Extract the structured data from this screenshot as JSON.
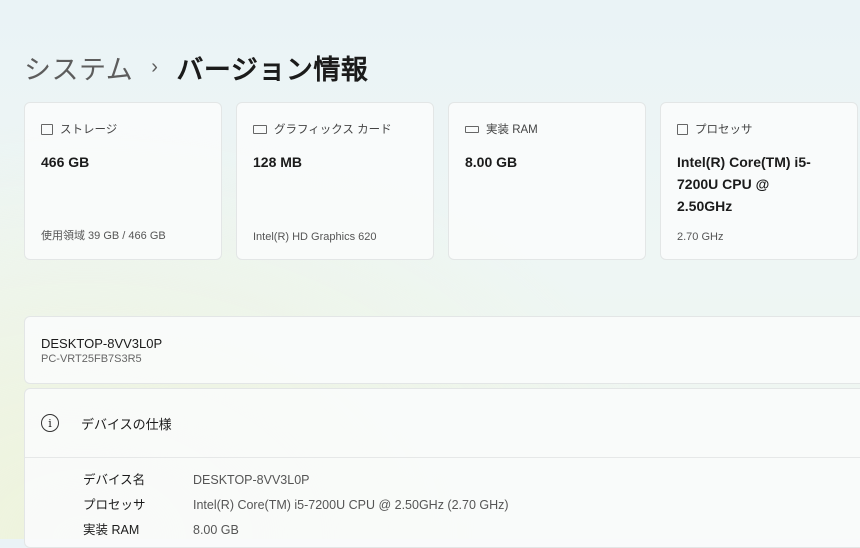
{
  "breadcrumb": {
    "parent": "システム",
    "separator": "›",
    "current": "バージョン情報"
  },
  "cards": [
    {
      "icon": "storage-icon",
      "label": "ストレージ",
      "value": "466 GB",
      "sub": "使用領域 39 GB / 466 GB"
    },
    {
      "icon": "graphics-card-icon",
      "label": "グラフィックス カード",
      "value": "128 MB",
      "sub": "Intel(R) HD Graphics 620"
    },
    {
      "icon": "ram-icon",
      "label": "実装 RAM",
      "value": "8.00 GB",
      "sub": ""
    },
    {
      "icon": "processor-icon",
      "label": "プロセッサ",
      "value": "Intel(R) Core(TM) i5-7200U CPU @ 2.50GHz",
      "sub": "2.70 GHz"
    }
  ],
  "device": {
    "name": "DESKTOP-8VV3L0P",
    "model": "PC-VRT25FB7S3R5"
  },
  "specs": {
    "title": "デバイスの仕様",
    "info_icon": "i",
    "rows": [
      {
        "key": "デバイス名",
        "value": "DESKTOP-8VV3L0P"
      },
      {
        "key": "プロセッサ",
        "value": "Intel(R) Core(TM) i5-7200U CPU @ 2.50GHz (2.70 GHz)"
      },
      {
        "key": "実装 RAM",
        "value": "8.00 GB"
      }
    ]
  }
}
